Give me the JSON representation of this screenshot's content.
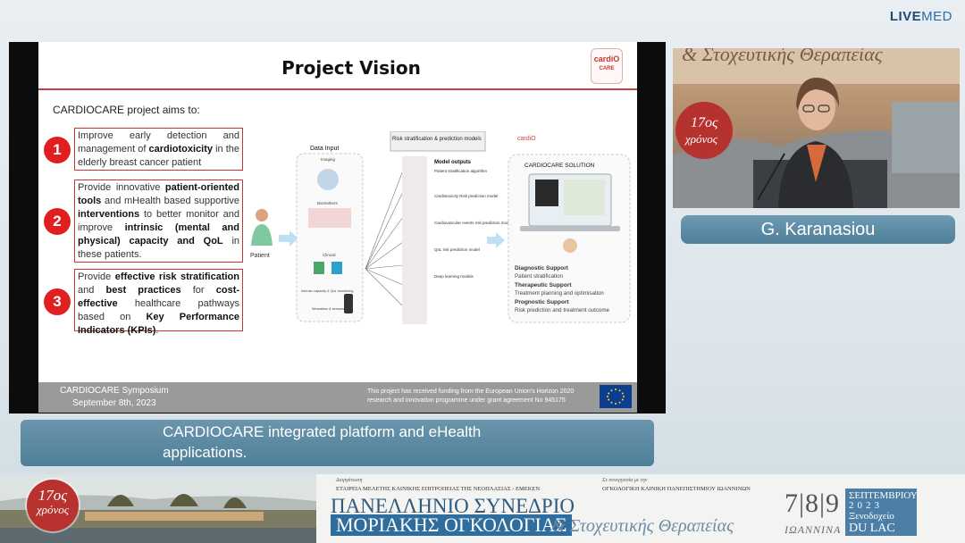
{
  "brand": {
    "bold": "LIVE",
    "light": "MED"
  },
  "slide": {
    "title": "Project Vision",
    "logo": {
      "main": "cardiO",
      "sub": "CARE"
    },
    "intro": "CARDIOCARE project aims to:",
    "aims": [
      {
        "num": "1",
        "lines": [
          "Improve early detection and management of",
          "cardiotoxicity",
          "in the elderly breast cancer patient"
        ]
      },
      {
        "num": "2",
        "lines": [
          "Provide innovative",
          "patient-oriented tools",
          "and mHealth based supportive",
          "interventions",
          "to better monitor and improve",
          "intrinsic (mental and physical) capacity and QoL",
          "in these patients."
        ]
      },
      {
        "num": "3",
        "lines": [
          "Provide",
          "effective risk stratification",
          "and",
          "best practices",
          "for",
          "cost-effective",
          "healthcare pathways based on",
          "Key Performance Indicators (KPIs)",
          "."
        ]
      }
    ],
    "diagram": {
      "data_input_title": "Data Input",
      "data_input_items": [
        "Imaging",
        "Biomarkers",
        "Clinical",
        "Intrinsic capacity & QoL monitoring",
        "Wearables & sensors"
      ],
      "patient_label": "Patient",
      "risk_title": "Risk stratification & prediction models",
      "model_outputs_title": "Model outputs",
      "model_outputs": [
        "Patient stratification algorithm",
        "Cardiotoxicity Risk prediction model",
        "Cardiovascular events risk prediction model",
        "QoL risk prediction model",
        "Deep learning models"
      ],
      "solution_title": "CARDIOCARE SOLUTION",
      "supports": [
        {
          "heading": "Diagnostic Support",
          "detail": "Patient stratification"
        },
        {
          "heading": "Therapeutic Support",
          "detail": "Treatment planning and optimisation"
        },
        {
          "heading": "Prognostic Support",
          "detail": "Risk prediction and treatment outcome"
        }
      ]
    },
    "footer": {
      "event": "CARDIOCARE Symposium",
      "date": "September 8th, 2023",
      "funding_line1": "This project has received funding from the European Union's Horizon 2020",
      "funding_line2": "research and innovation programme under grant agreement No 945175"
    }
  },
  "speaker": {
    "name": "G. Karanasiou"
  },
  "caption": {
    "line1": "CARDIOCARE integrated platform and eHealth",
    "line2": "applications."
  },
  "banner": {
    "seal_top": "17ος",
    "seal_bottom": "χρόνος",
    "organizer_label": "Διοργάνωση",
    "organizer": "ΕΤΑΙΡΕΙΑ ΜΕΛΕΤΗΣ ΚΛΙΝΙΚΗΣ ΕΠΙΤΡΟΠΕΙΑΣ ΤΗΣ ΝΕΟΠΛΑΣΙΑΣ - ΕΜΕΚΕΝ",
    "partner_label": "Σε συνεργασία με την",
    "partner": "ΟΓΚΟΛΟΓΙΚΗ ΚΛΙΝΙΚΗ ΠΑΝΕΠΙΣΤΗΜΙΟΥ ΙΩΑΝΝΙΝΩΝ",
    "congress": "ΠΑΝΕΛΛΗΝΙΟ ΣΥΝΕΔΡΙΟ",
    "topic1": "ΜΟΡΙΑΚΗΣ ΟΓΚΟΛΟΓΙΑΣ",
    "topic2": "& Στοχευτικής Θεραπείας",
    "days": "7|8|9",
    "city": "ΙΩΑΝΝΙΝΑ",
    "month": "ΣΕΠΤΕΜΒΡΙΟΥ",
    "year": "2023",
    "hotel": "Ξενοδοχείο",
    "hotel_name": "DU LAC"
  },
  "colors": {
    "accent_red": "#e02020",
    "caption_blue": "#5a87a1",
    "banner_blue": "#2f6e9c"
  }
}
